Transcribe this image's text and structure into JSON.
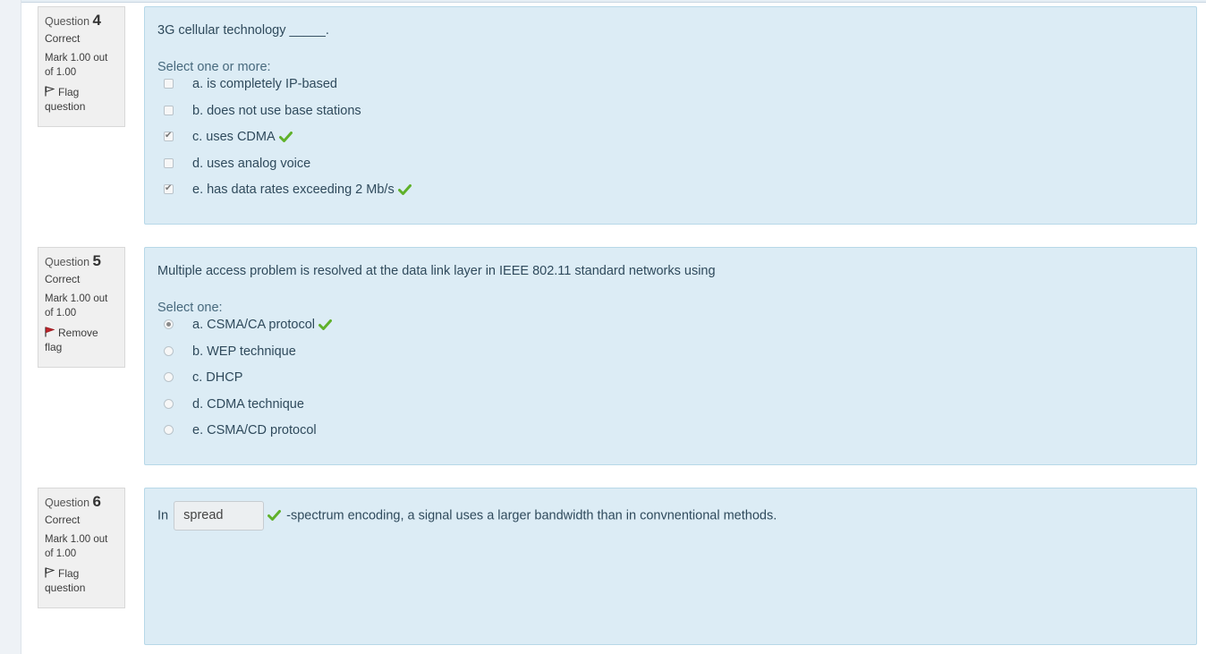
{
  "questions": [
    {
      "label": "Question",
      "number": "4",
      "state": "Correct",
      "grade": "Mark 1.00 out of 1.00",
      "flag_label": "Flag question",
      "text": "3G cellular technology _____.",
      "prompt": "Select one or more:",
      "answers": [
        {
          "label": "a. is completely IP-based",
          "checked": false,
          "correct": false
        },
        {
          "label": "b. does not use base stations",
          "checked": false,
          "correct": false
        },
        {
          "label": "c. uses CDMA",
          "checked": true,
          "correct": true
        },
        {
          "label": "d. uses analog voice",
          "checked": false,
          "correct": false
        },
        {
          "label": "e. has data rates exceeding 2 Mb/s",
          "checked": true,
          "correct": true
        }
      ]
    },
    {
      "label": "Question",
      "number": "5",
      "state": "Correct",
      "grade": "Mark 1.00 out of 1.00",
      "flag_label": "Remove flag",
      "text": "Multiple access problem is resolved at the data link layer in IEEE 802.11 standard networks using",
      "prompt": "Select one:",
      "answers": [
        {
          "label": "a. CSMA/CA protocol",
          "checked": true,
          "correct": true
        },
        {
          "label": "b. WEP technique",
          "checked": false,
          "correct": false
        },
        {
          "label": "c. DHCP",
          "checked": false,
          "correct": false
        },
        {
          "label": "d. CDMA technique",
          "checked": false,
          "correct": false
        },
        {
          "label": "e. CSMA/CD protocol",
          "checked": false,
          "correct": false
        }
      ]
    },
    {
      "label": "Question",
      "number": "6",
      "state": "Correct",
      "grade": "Mark 1.00 out of 1.00",
      "flag_label": "Flag question",
      "text_before": "In",
      "gap_value": "spread",
      "text_after": "-spectrum encoding, a signal uses a larger bandwidth than in convnentional methods."
    }
  ],
  "colors": {
    "content_bg": "#dcecf5",
    "info_bg": "#f0f0f0",
    "correct_tick": "#5fb12a",
    "flag_red": "#c0262c"
  },
  "icons": {
    "correct": "check-icon",
    "flag_outline": "flag-outline-icon",
    "flag_red": "flag-red-icon"
  }
}
